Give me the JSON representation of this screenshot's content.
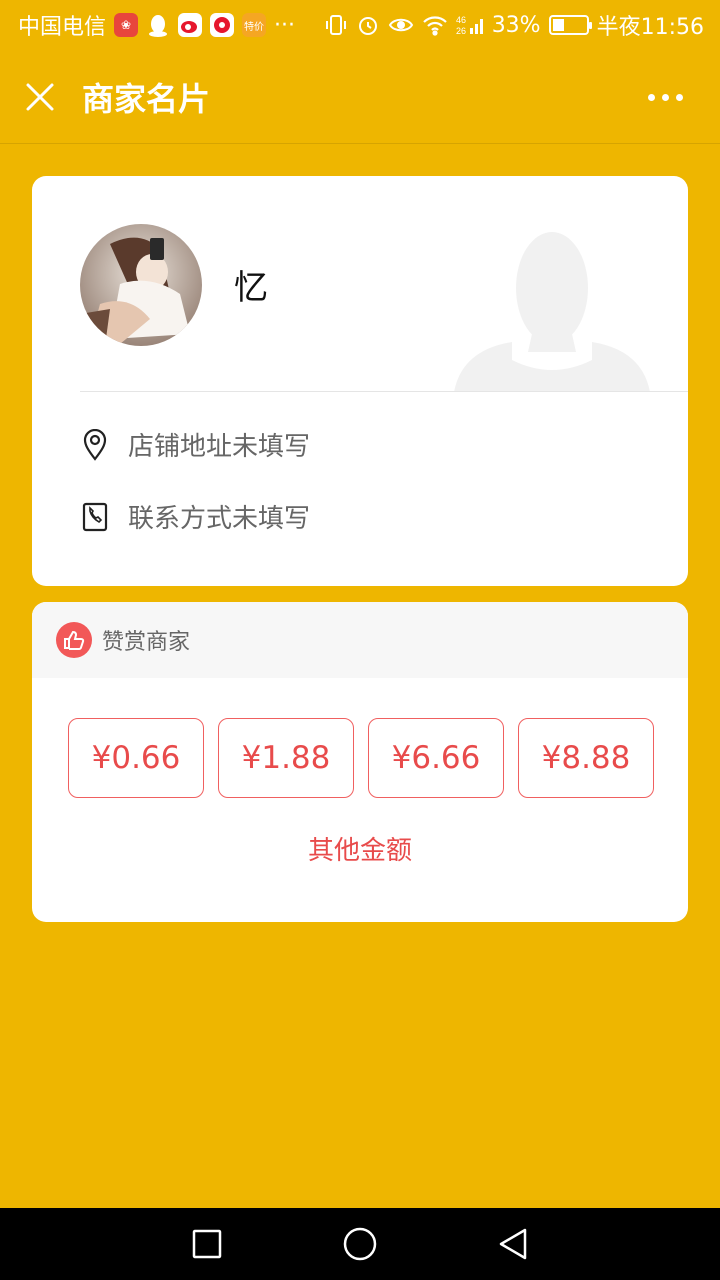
{
  "status_bar": {
    "carrier": "中国电信",
    "more": "···",
    "network": "46\n26",
    "battery_pct": "33%",
    "time": "半夜11:56",
    "app_badge_text": "特价"
  },
  "nav": {
    "title": "商家名片"
  },
  "merchant": {
    "name": "忆",
    "address": "店铺地址未填写",
    "contact": "联系方式未填写"
  },
  "reward": {
    "title": "赞赏商家",
    "amounts": [
      "¥0.66",
      "¥1.88",
      "¥6.66",
      "¥8.88"
    ],
    "other": "其他金额"
  },
  "colors": {
    "background": "#EEB600",
    "accent_red": "#E84B4B"
  },
  "icons": [
    "close-icon",
    "more-icon",
    "location-icon",
    "phone-icon",
    "thumbs-up-icon",
    "recent-apps-icon",
    "home-icon",
    "back-icon"
  ]
}
